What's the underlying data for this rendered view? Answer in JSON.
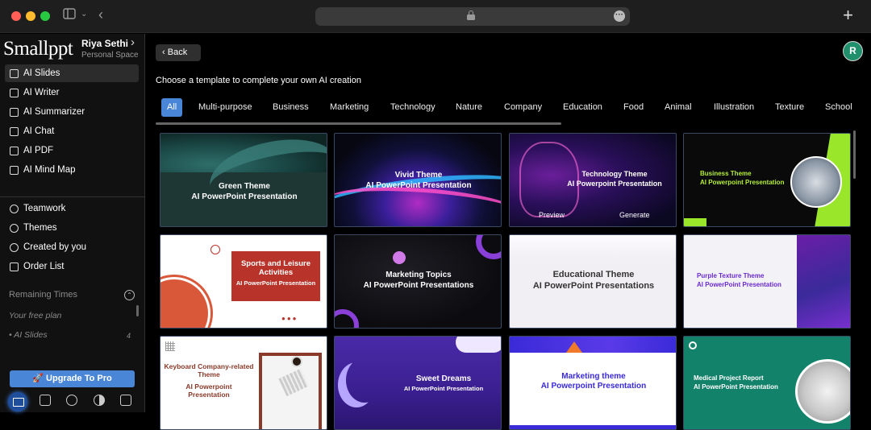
{
  "sidebar": {
    "logo": "Smallppt",
    "user_name": "Riya Sethi",
    "user_space": "Personal Space",
    "nav_primary": [
      {
        "label": "AI Slides",
        "icon": "slides-icon"
      },
      {
        "label": "AI Writer",
        "icon": "pen-icon"
      },
      {
        "label": "AI Summarizer",
        "icon": "list-icon"
      },
      {
        "label": "AI Chat",
        "icon": "chat-icon"
      },
      {
        "label": "AI PDF",
        "icon": "pdf-icon"
      },
      {
        "label": "AI Mind Map",
        "icon": "mindmap-icon"
      }
    ],
    "nav_secondary": [
      {
        "label": "Teamwork",
        "icon": "team-icon"
      },
      {
        "label": "Themes",
        "icon": "palette-icon"
      },
      {
        "label": "Created by you",
        "icon": "user-icon"
      },
      {
        "label": "Order List",
        "icon": "clipboard-icon"
      }
    ],
    "remaining_label": "Remaining Times",
    "plan_label": "Your free plan",
    "plan_item_label": "• AI Slides",
    "plan_item_count": "4",
    "upgrade_label": "Upgrade To Pro"
  },
  "main": {
    "back_label": "Back",
    "avatar_initial": "R",
    "subtitle": "Choose a template to complete your own AI creation",
    "tabs": [
      "All",
      "Multi-purpose",
      "Business",
      "Marketing",
      "Technology",
      "Nature",
      "Company",
      "Education",
      "Food",
      "Animal",
      "Illustration",
      "Texture",
      "School"
    ],
    "active_tab": "All",
    "cards": [
      {
        "title": "Green Theme",
        "subtitle": "AI PowerPoint Presentation"
      },
      {
        "title": "Vivid Theme",
        "subtitle": "AI PowerPoint Presentation"
      },
      {
        "title": "Technology Theme",
        "subtitle": "AI Powerpoint Presentation",
        "preview": "Preview",
        "generate": "Generate"
      },
      {
        "title": "Business Theme",
        "subtitle": "AI Powerpoint Presentation"
      },
      {
        "title": "Sports and Leisure Activities",
        "subtitle": "AI PowerPoint Presentation"
      },
      {
        "title": "Marketing Topics",
        "subtitle": "AI PowerPoint Presentations"
      },
      {
        "title": "Educational Theme",
        "subtitle": "AI PowerPoint Presentations"
      },
      {
        "title": "Purple Texture Theme",
        "subtitle": "AI PowerPoint Presentation"
      },
      {
        "title": "Keyboard Company-related Theme",
        "subtitle": "AI Powerpoint Presentation"
      },
      {
        "title": "Sweet Dreams",
        "subtitle": "AI PowerPoint Presentation"
      },
      {
        "title": "Marketing theme",
        "subtitle": "AI Powerpoint Presentation"
      },
      {
        "title": "Medical Project Report",
        "subtitle": "AI PowerPoint Presentation"
      }
    ]
  }
}
